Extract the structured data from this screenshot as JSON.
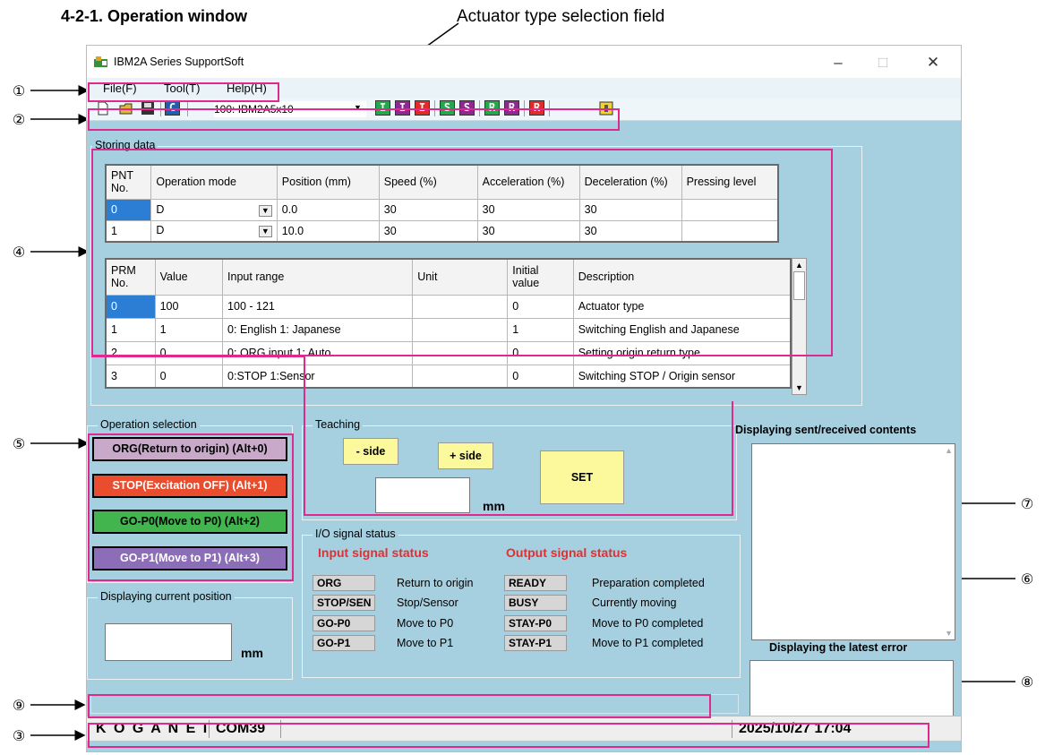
{
  "doc": {
    "heading": "4-2-1. Operation window",
    "callout_actuator": "Actuator type selection field",
    "callouts": [
      "①",
      "②",
      "③",
      "④",
      "⑤",
      "⑥",
      "⑦",
      "⑧",
      "⑨"
    ]
  },
  "window": {
    "title": "IBM2A Series SupportSoft",
    "controls": {
      "minimize": "–",
      "maximize": "□",
      "close": "✕"
    }
  },
  "menu": [
    "File(F)",
    "Tool(T)",
    "Help(H)"
  ],
  "toolbar": {
    "actuator_value": "100: IBM2A5x10",
    "icons": [
      "new-file-icon",
      "open-file-icon",
      "save-icon",
      "c-icon"
    ],
    "c_label": "C",
    "letter_buttons": [
      {
        "label": "I",
        "color": "#25a84b"
      },
      {
        "label": "I",
        "color": "#8c2a8f"
      },
      {
        "label": "I",
        "color": "#e02b2b"
      },
      {
        "label": "S",
        "color": "#25a84b"
      },
      {
        "label": "S",
        "color": "#8c2a8f"
      },
      {
        "label": "R",
        "color": "#25a84b"
      },
      {
        "label": "R",
        "color": "#8c2a8f"
      },
      {
        "label": "R",
        "color": "#e02b2b"
      }
    ]
  },
  "storing": {
    "label": "Storing data",
    "pnt_headers": [
      "PNT No.",
      "Operation mode",
      "Position (mm)",
      "Speed (%)",
      "Acceleration (%)",
      "Deceleration (%)",
      "Pressing level"
    ],
    "pnt_rows": [
      [
        "0",
        "D",
        "0.0",
        "30",
        "30",
        "30",
        ""
      ],
      [
        "1",
        "D",
        "10.0",
        "30",
        "30",
        "30",
        ""
      ]
    ],
    "prm_headers": [
      "PRM No.",
      "Value",
      "Input range",
      "Unit",
      "Initial value",
      "Description"
    ],
    "prm_rows": [
      [
        "0",
        "100",
        "100 - 121",
        "",
        "0",
        "Actuator type"
      ],
      [
        "1",
        "1",
        "0: English   1: Japanese",
        "",
        "1",
        "Switching English and Japanese"
      ],
      [
        "2",
        "0",
        "0: ORG input   1: Auto.",
        "",
        "0",
        "Setting origin return type"
      ],
      [
        "3",
        "0",
        "0:STOP  1:Sensor",
        "",
        "0",
        "Switching STOP / Origin sensor"
      ]
    ]
  },
  "operation": {
    "label": "Operation selection",
    "buttons": [
      {
        "label": "ORG(Return to origin) (Alt+0)",
        "color": "#c8a9c9",
        "text": "#000"
      },
      {
        "label": "STOP(Excitation OFF) (Alt+1)",
        "color": "#ea4c2e",
        "text": "#fff"
      },
      {
        "label": "GO-P0(Move to P0) (Alt+2)",
        "color": "#42b54f",
        "text": "#000"
      },
      {
        "label": "GO-P1(Move to P1) (Alt+3)",
        "color": "#8c6db8",
        "text": "#fff"
      }
    ]
  },
  "current_position": {
    "label": "Displaying current position",
    "unit": "mm"
  },
  "teaching": {
    "label": "Teaching",
    "minus": "- side",
    "plus": "+ side",
    "set": "SET",
    "unit": "mm"
  },
  "io": {
    "label": "I/O signal status",
    "input_header": "Input signal status",
    "output_header": "Output signal status",
    "inputs": [
      {
        "name": "ORG",
        "desc": "Return to origin"
      },
      {
        "name": "STOP/SEN",
        "desc": "Stop/Sensor"
      },
      {
        "name": "GO-P0",
        "desc": "Move to P0"
      },
      {
        "name": "GO-P1",
        "desc": "Move to P1"
      }
    ],
    "outputs": [
      {
        "name": "READY",
        "desc": "Preparation completed"
      },
      {
        "name": "BUSY",
        "desc": "Currently moving"
      },
      {
        "name": "STAY-P0",
        "desc": "Move to P0 completed"
      },
      {
        "name": "STAY-P1",
        "desc": "Move to P1 completed"
      }
    ]
  },
  "comms": {
    "label": "Displaying sent/received contents"
  },
  "error": {
    "label": "Displaying the latest error"
  },
  "status": {
    "brand": "K O G A N E I",
    "port": "COM39",
    "datetime": "2025/10/27 17:04"
  }
}
